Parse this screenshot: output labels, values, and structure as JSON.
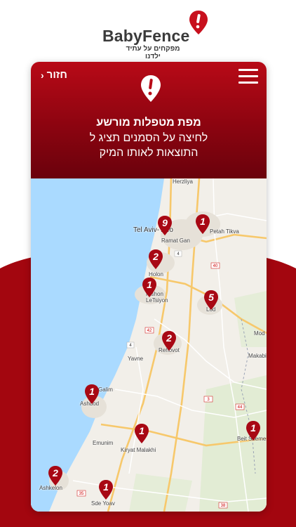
{
  "brand": {
    "name": "BabyFence",
    "tagline": "מפקחים על עתיד ילדנו"
  },
  "header": {
    "back_label": "חזור",
    "title": "מפת מטפלות מורשע",
    "subtitle_line1": "לחיצה על הסמנים תציג ל",
    "subtitle_line2": "התוצאות לאותו המיק"
  },
  "map": {
    "labels": {
      "herzliya": "Herzliya",
      "tel_aviv": "Tel Aviv-Yafo",
      "petah_tikva": "Petah Tikva",
      "ramat_gan": "Ramat Gan",
      "holon": "Holon",
      "rishon": "Rishon LeTsiyon",
      "lod": "Lod",
      "rehovot": "Rehovot",
      "yavne": "Yavne",
      "ashdod": "Ashdod",
      "galim": "Galim",
      "emunim": "Emunim",
      "kiryat_malakhi": "Kiryat Malakhi",
      "beit_shemesh": "Beit Shemesh",
      "ashkelon": "Ashkelon",
      "sde_yoav": "Sde Yoav",
      "modiin": "Mod",
      "makabi": "Makabi"
    },
    "markers": [
      {
        "count": "9"
      },
      {
        "count": "1"
      },
      {
        "count": "2"
      },
      {
        "count": "1"
      },
      {
        "count": "5"
      },
      {
        "count": "2"
      },
      {
        "count": "1"
      },
      {
        "count": "1"
      },
      {
        "count": "1"
      },
      {
        "count": "2"
      },
      {
        "count": "1"
      }
    ]
  },
  "colors": {
    "brand_red": "#b80a17",
    "sea": "#aadaff",
    "land": "#f2efe9"
  },
  "icons": {
    "brand": "alert-pin-icon",
    "header": "alert-pin-icon",
    "menu": "hamburger-menu-icon",
    "back": "chevron-left-icon"
  }
}
